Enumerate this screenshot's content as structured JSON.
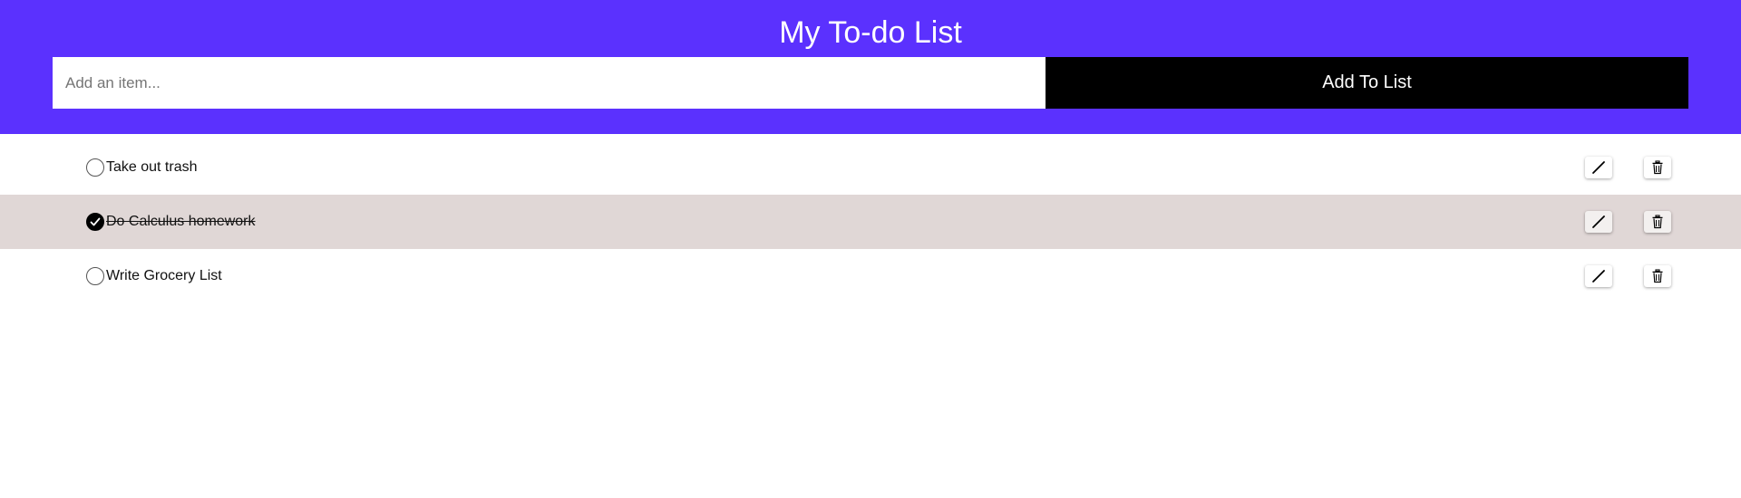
{
  "header": {
    "title": "My To-do List",
    "background_color": "#5b31fe"
  },
  "add_form": {
    "placeholder": "Add an item...",
    "value": "",
    "button_label": "Add To List"
  },
  "todos": [
    {
      "text": "Take out trash",
      "completed": false
    },
    {
      "text": "Do Calculus homework",
      "completed": true
    },
    {
      "text": "Write Grocery List",
      "completed": false
    }
  ],
  "icons": {
    "edit": "pencil-icon",
    "delete": "trash-icon",
    "complete": "checkmark-icon"
  },
  "colors": {
    "completed_row": "#e0d7d6",
    "add_button": "#000000"
  }
}
